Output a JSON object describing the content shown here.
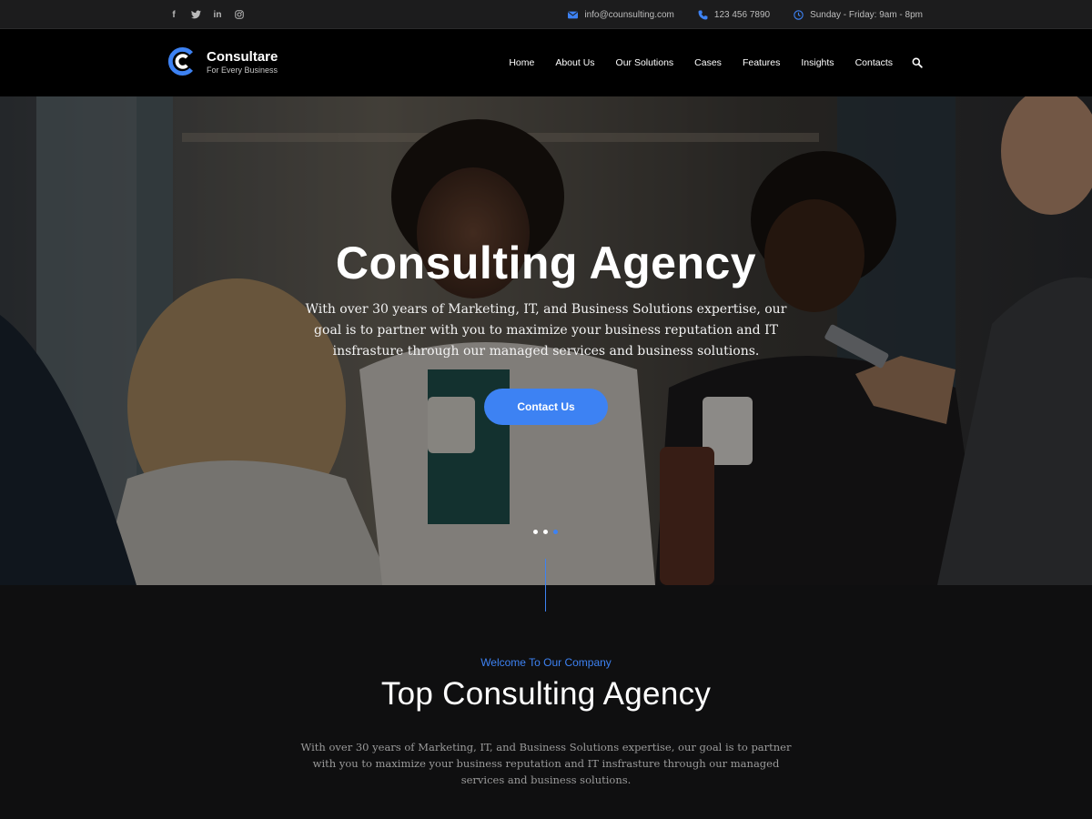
{
  "topbar": {
    "social": [
      {
        "icon": "facebook-icon",
        "glyph": "f"
      },
      {
        "icon": "twitter-icon",
        "glyph": "t"
      },
      {
        "icon": "linkedin-icon",
        "glyph": "in"
      },
      {
        "icon": "instagram-icon",
        "glyph": "◎"
      }
    ],
    "email": "info@counsulting.com",
    "phone": "123 456 7890",
    "hours": "Sunday - Friday: 9am - 8pm"
  },
  "header": {
    "brand_name": "Consultare",
    "brand_tagline": "For Every Business",
    "nav": [
      "Home",
      "About Us",
      "Our Solutions",
      "Cases",
      "Features",
      "Insights",
      "Contacts"
    ]
  },
  "hero": {
    "title": "Consulting Agency",
    "text": "With over 30 years of Marketing, IT, and Business Solutions expertise, our goal is to partner with you to  maximize your business reputation and IT insfrasture through our managed services and  business solutions.",
    "button": "Contact Us",
    "slide_count": 3,
    "active_slide": 3
  },
  "intro": {
    "kicker": "Welcome To Our Company",
    "title": "Top Consulting Agency",
    "text": "With over 30 years of Marketing, IT, and Business Solutions expertise, our goal is to partner with you to  maximize your business reputation and IT insfrasture through our managed services and business solutions."
  },
  "colors": {
    "accent": "#3d82f3",
    "topbar_bg": "#1c1c1d",
    "header_bg": "#000000",
    "page_bg": "#0f0f10"
  }
}
